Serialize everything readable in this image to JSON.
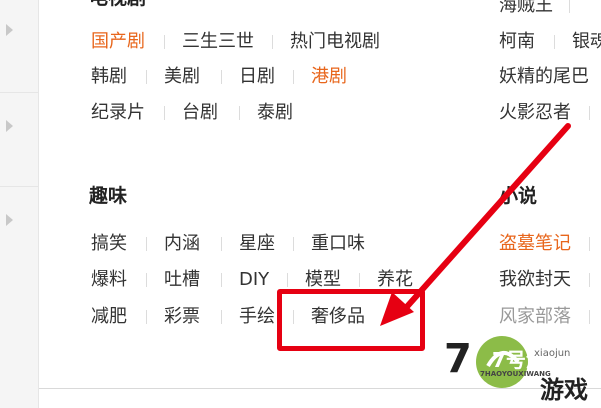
{
  "sections": {
    "tv_heading": "电视剧",
    "fun": {
      "heading": "趣味",
      "rows": [
        [
          "搞笑",
          "内涵",
          "星座",
          "重口味"
        ],
        [
          "爆料",
          "吐槽",
          "DIY",
          "模型",
          "养花"
        ],
        [
          "减肥",
          "彩票",
          "手绘",
          "奢侈品"
        ]
      ]
    },
    "tv": {
      "rows": [
        [
          "国产剧",
          "三生三世",
          "热门电视剧"
        ],
        [
          "韩剧",
          "美剧",
          "日剧",
          "港剧"
        ],
        [
          "纪录片",
          "台剧",
          "泰剧"
        ]
      ]
    },
    "right": {
      "tv_col": [
        "海贼王",
        "柯南",
        "银魂",
        "妖精的尾巴",
        "火影忍者"
      ],
      "novel": {
        "heading": "小说",
        "items": [
          "盗墓笔记",
          "我欲封天",
          "风家部落"
        ]
      }
    }
  },
  "watermark": {
    "brand": "7号游戏网",
    "sub": "7HAOYOUXIWANG",
    "tag": "游戏",
    "extra": "xiaojun"
  },
  "colors": {
    "orange": "#e8661c",
    "highlight": "#e60012"
  }
}
